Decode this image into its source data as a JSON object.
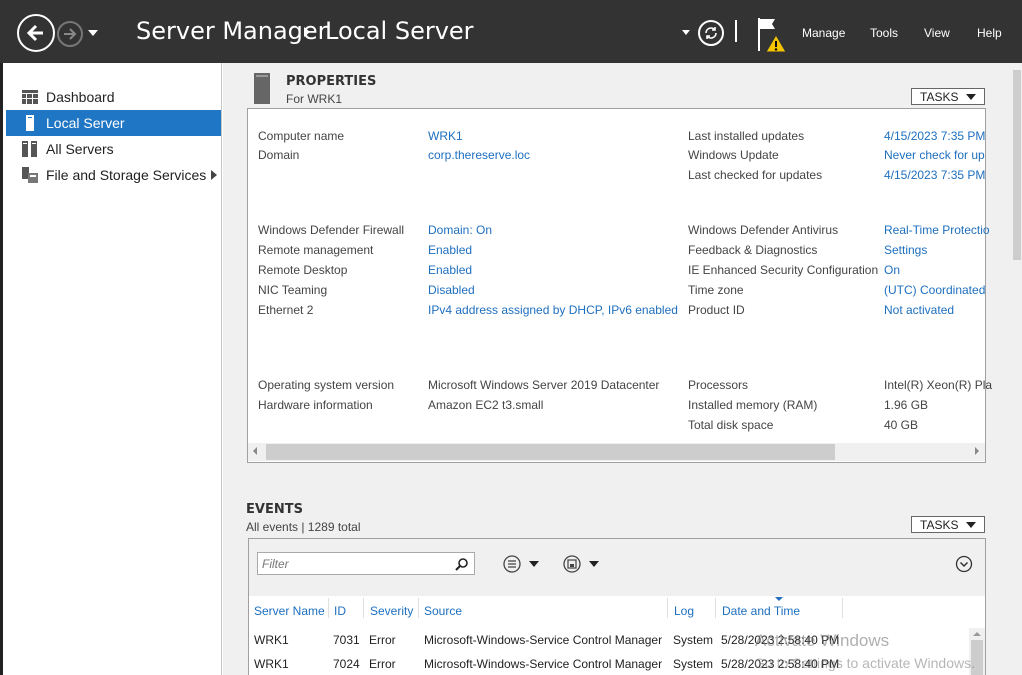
{
  "header": {
    "app_title": "Server Manager",
    "page_title": "Local Server",
    "menu": [
      "Manage",
      "Tools",
      "View",
      "Help"
    ],
    "colors": {
      "titlebar": "#333333",
      "accent": "#1e76c4",
      "link": "#1e6fbf"
    }
  },
  "sidebar": {
    "items": [
      {
        "label": "Dashboard",
        "icon": "dashboard-icon"
      },
      {
        "label": "Local Server",
        "icon": "server-icon",
        "active": true
      },
      {
        "label": "All Servers",
        "icon": "servers-icon"
      },
      {
        "label": "File and Storage Services",
        "icon": "storage-icon"
      }
    ]
  },
  "properties": {
    "title": "PROPERTIES",
    "subtitle": "For WRK1",
    "tasks_label": "TASKS",
    "left": [
      {
        "label": "Computer name",
        "value": "WRK1"
      },
      {
        "label": "Domain",
        "value": "corp.thereserve.loc"
      },
      {
        "label": "Windows Defender Firewall",
        "value": "Domain: On"
      },
      {
        "label": "Remote management",
        "value": "Enabled"
      },
      {
        "label": "Remote Desktop",
        "value": "Enabled"
      },
      {
        "label": "NIC Teaming",
        "value": "Disabled"
      },
      {
        "label": "Ethernet 2",
        "value": "IPv4 address assigned by DHCP, IPv6 enabled"
      },
      {
        "label": "Operating system version",
        "value": "Microsoft Windows Server 2019 Datacenter"
      },
      {
        "label": "Hardware information",
        "value": "Amazon EC2 t3.small"
      }
    ],
    "right": [
      {
        "label": "Last installed updates",
        "value": "4/15/2023 7:35 PM"
      },
      {
        "label": "Windows Update",
        "value": "Never check for up"
      },
      {
        "label": "Last checked for updates",
        "value": "4/15/2023 7:35 PM"
      },
      {
        "label": "Windows Defender Antivirus",
        "value": "Real-Time Protectio"
      },
      {
        "label": "Feedback & Diagnostics",
        "value": "Settings"
      },
      {
        "label": "IE Enhanced Security Configuration",
        "value": "On"
      },
      {
        "label": "Time zone",
        "value": "(UTC) Coordinated"
      },
      {
        "label": "Product ID",
        "value": "Not activated"
      },
      {
        "label": "Processors",
        "value": "Intel(R) Xeon(R) Pla"
      },
      {
        "label": "Installed memory (RAM)",
        "value": "1.96 GB"
      },
      {
        "label": "Total disk space",
        "value": "40 GB"
      }
    ]
  },
  "events": {
    "title": "EVENTS",
    "subtitle": "All events | 1289 total",
    "tasks_label": "TASKS",
    "filter_placeholder": "Filter",
    "columns": [
      "Server Name",
      "ID",
      "Severity",
      "Source",
      "Log",
      "Date and Time"
    ],
    "rows": [
      [
        "WRK1",
        "7031",
        "Error",
        "Microsoft-Windows-Service Control Manager",
        "System",
        "5/28/2023 2:58:40 PM"
      ],
      [
        "WRK1",
        "7024",
        "Error",
        "Microsoft-Windows-Service Control Manager",
        "System",
        "5/28/2023 2:58:40 PM"
      ]
    ]
  },
  "watermark": {
    "line1": "Activate Windows",
    "line2": "Go to Settings to activate Windows."
  }
}
